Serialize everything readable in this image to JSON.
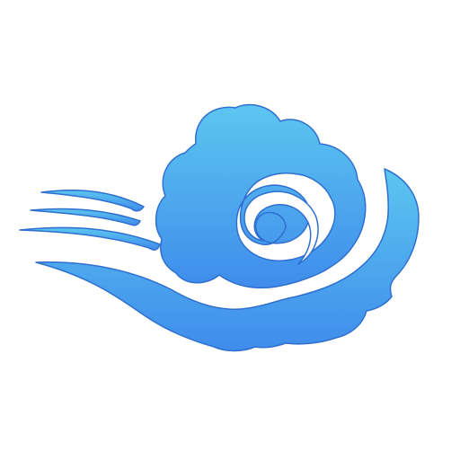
{
  "icon": {
    "name": "cloud-wind-logo-icon",
    "colors": {
      "gradient_top": "#5cc6f0",
      "gradient_bottom": "#3f8ceb",
      "outline": "#2f6fcf",
      "background": "#ffffff"
    }
  }
}
